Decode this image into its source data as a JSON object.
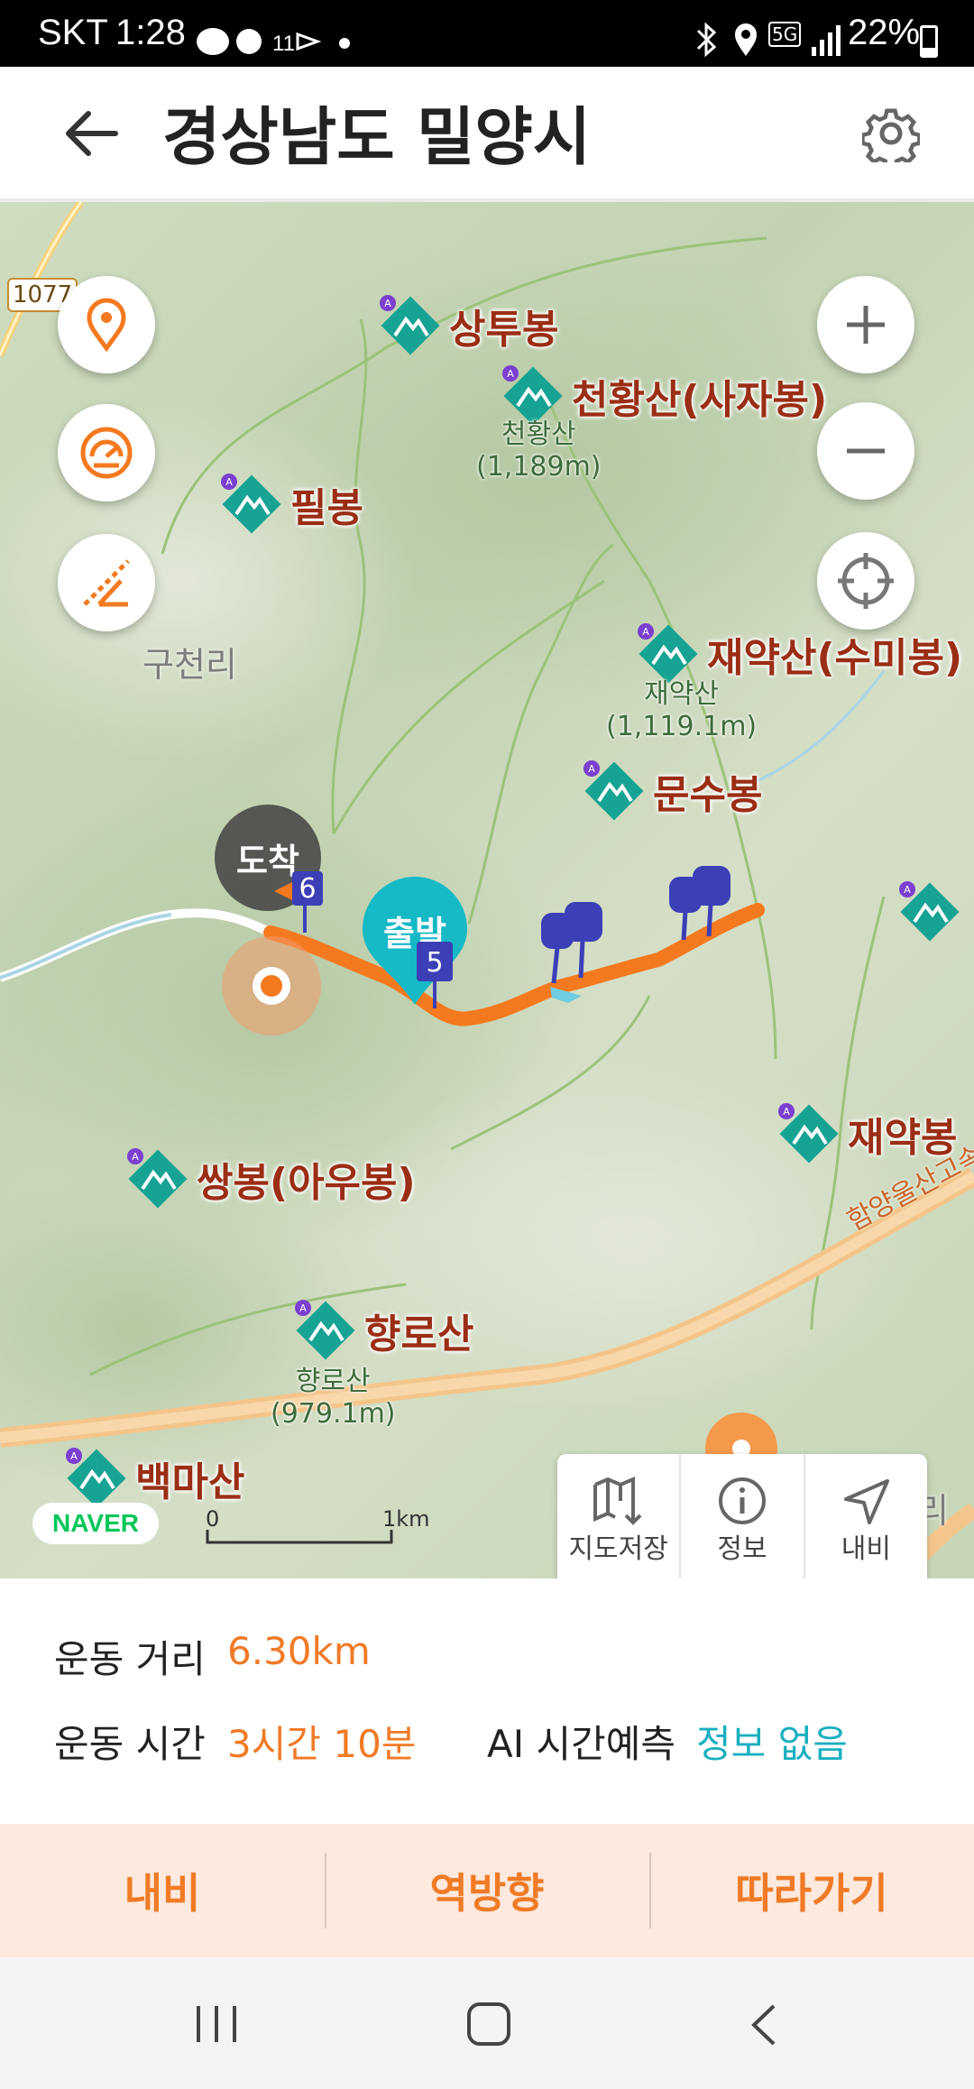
{
  "status_bar": {
    "carrier": "SKT",
    "time": "1:28",
    "battery": "22%",
    "network": "5G",
    "icons": [
      "talk-icon",
      "settings-app-icon",
      "notification-icon",
      "dot-icon",
      "bluetooth-icon",
      "location-icon",
      "signal-icon",
      "battery-icon"
    ]
  },
  "header": {
    "title": "경상남도 밀양시",
    "back_icon": "back-arrow-icon",
    "settings_icon": "gear-icon"
  },
  "map": {
    "road_number": "1077",
    "peaks": [
      {
        "name": "상투봉"
      },
      {
        "name": "천황산(사자봉)",
        "elev_name": "천황산",
        "elev": "(1,189m)"
      },
      {
        "name": "재약산(수미봉)",
        "elev_name": "재약산",
        "elev": "(1,119.1m)"
      },
      {
        "name": "필봉"
      },
      {
        "name": "문수봉"
      },
      {
        "name": "재약봉"
      },
      {
        "name": "쌍봉(아우봉)"
      },
      {
        "name": "향로산",
        "elev_name": "향로산",
        "elev": "(979.1m)"
      },
      {
        "name": "백마산"
      }
    ],
    "villages": [
      "구천리",
      "선리"
    ],
    "road_label": "함양울산고속",
    "markers": {
      "arrival": "도착",
      "departure": "출발",
      "flag_arrival": "6",
      "flag_departure": "5"
    },
    "scale": {
      "start": "0",
      "end": "1km"
    },
    "brand": "NAVER",
    "controls": [
      "location-pin-button",
      "speedometer-button",
      "slope-button",
      "zoom-in-button",
      "zoom-out-button",
      "recenter-button"
    ],
    "actions": [
      {
        "label": "지도저장",
        "icon": "map-save-icon"
      },
      {
        "label": "정보",
        "icon": "info-icon"
      },
      {
        "label": "내비",
        "icon": "navigation-icon"
      }
    ],
    "colors": {
      "route": "#f5791f",
      "peak_icon": "#16a394",
      "marker_teal": "#16b9c6",
      "flag": "#3c3fb6"
    }
  },
  "info": {
    "distance_label": "운동 거리",
    "distance_value": "6.30km",
    "time_label": "운동 시간",
    "time_value": "3시간 10분",
    "ai_label": "AI 시간예측",
    "ai_value": "정보 없음"
  },
  "bottom_buttons": [
    "내비",
    "역방향",
    "따라가기"
  ],
  "nav_bar": {
    "icons": [
      "recent-apps-icon",
      "home-icon",
      "back-icon"
    ]
  }
}
